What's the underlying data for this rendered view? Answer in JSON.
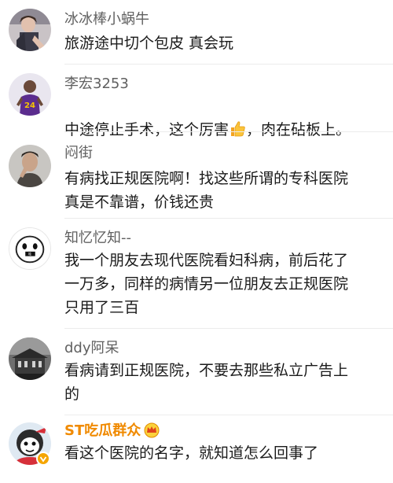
{
  "comments": [
    {
      "username": "冰冰棒小蜗牛",
      "text": "旅游途中切个包皮 真会玩",
      "avatar_icon": "woman-photo-avatar-icon"
    },
    {
      "username": "李宏3253",
      "text_before": "中途停止手术，这个厉害",
      "text_after": "，肉在砧板上。",
      "emoji_icon": "thumbs-up-emoji-icon",
      "avatar_icon": "basketball-player-avatar-icon"
    },
    {
      "username": "闷街",
      "text": "有病找正规医院啊！找这些所谓的专科医院\n真是不靠谱，价钱还贵",
      "avatar_icon": "man-photo-avatar-icon"
    },
    {
      "username": "知忆忆知--",
      "text": "我一个朋友去现代医院看妇科病，前后花了\n一万多，同样的病情另一位朋友去正规医院\n只用了三百",
      "avatar_icon": "cartoon-face-avatar-icon"
    },
    {
      "username": "ddy阿呆",
      "text": "看病请到正规医院，不要去那些私立广告上\n的",
      "avatar_icon": "building-photo-avatar-icon"
    },
    {
      "username": "ST吃瓜群众",
      "text": "看这个医院的名字，就知道怎么回事了",
      "avatar_icon": "cartoon-character-avatar-icon",
      "vip_badge_icon": "vip-crown-badge-icon",
      "verified_icon": "verified-v-icon"
    }
  ],
  "colors": {
    "username": "#606060",
    "vip_username": "#f08a00",
    "text": "#1a1a1a",
    "divider": "#ececec"
  }
}
